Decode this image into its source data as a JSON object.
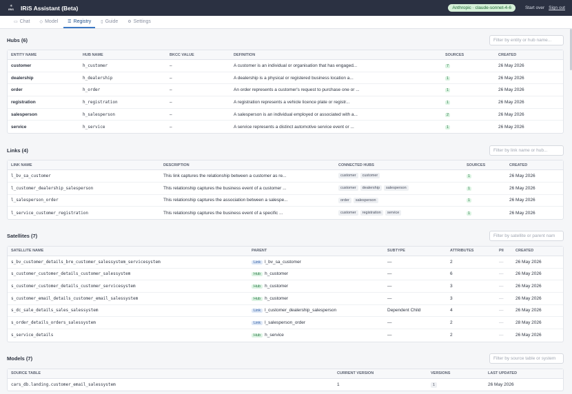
{
  "app": {
    "logo_text": "IRiS",
    "title": "IRiS Assistant (Beta)",
    "model": "Anthropic · claude-sonnet-4-6",
    "start_over": "Start over",
    "sign_out": "Sign out"
  },
  "tabs": [
    {
      "label": "Chat",
      "icon": "chat-icon"
    },
    {
      "label": "Model",
      "icon": "model-icon"
    },
    {
      "label": "Registry",
      "icon": "registry-icon"
    },
    {
      "label": "Guide",
      "icon": "guide-icon"
    },
    {
      "label": "Settings",
      "icon": "settings-icon"
    }
  ],
  "active_tab": "Registry",
  "hubs": {
    "title": "Hubs (6)",
    "filter_placeholder": "Filter by entity or hub name...",
    "columns": [
      "Entity Name",
      "Hub Name",
      "BKCC Value",
      "Definition",
      "Sources",
      "Created"
    ],
    "rows": [
      {
        "entity": "customer",
        "hub": "h_customer",
        "bkcc": "–",
        "definition": "A customer is an individual or organisation that has engaged...",
        "sources": "7",
        "created": "26 May 2026"
      },
      {
        "entity": "dealership",
        "hub": "h_dealership",
        "bkcc": "–",
        "definition": "A dealership is a physical or registered business location a...",
        "sources": "1",
        "created": "26 May 2026"
      },
      {
        "entity": "order",
        "hub": "h_order",
        "bkcc": "–",
        "definition": "An order represents a customer's request to purchase one or ...",
        "sources": "1",
        "created": "26 May 2026"
      },
      {
        "entity": "registration",
        "hub": "h_registration",
        "bkcc": "–",
        "definition": "A registration represents a vehicle licence plate or registr...",
        "sources": "1",
        "created": "26 May 2026"
      },
      {
        "entity": "salesperson",
        "hub": "h_salesperson",
        "bkcc": "–",
        "definition": "A salesperson is an individual employed or associated with a...",
        "sources": "2",
        "created": "26 May 2026"
      },
      {
        "entity": "service",
        "hub": "h_service",
        "bkcc": "–",
        "definition": "A service represents a distinct automotive service event or ...",
        "sources": "1",
        "created": "26 May 2026"
      }
    ]
  },
  "links": {
    "title": "Links (4)",
    "filter_placeholder": "Filter by link name or hub...",
    "columns": [
      "Link Name",
      "Description",
      "Connected Hubs",
      "Sources",
      "Created"
    ],
    "rows": [
      {
        "name": "l_bv_sa_customer",
        "description": "This link captures the relationship between a customer as re...",
        "hubs": [
          "customer",
          "customer"
        ],
        "sources": "1",
        "created": "26 May 2026"
      },
      {
        "name": "l_customer_dealership_salesperson",
        "description": "This relationship captures the business event of a customer ...",
        "hubs": [
          "customer",
          "dealership",
          "salesperson"
        ],
        "sources": "1",
        "created": "26 May 2026"
      },
      {
        "name": "l_salesperson_order",
        "description": "This relationship captures the association between a salespe...",
        "hubs": [
          "order",
          "salesperson"
        ],
        "sources": "1",
        "created": "26 May 2026"
      },
      {
        "name": "l_service_customer_registration",
        "description": "This relationship captures the business event of a specific ...",
        "hubs": [
          "customer",
          "registration",
          "service"
        ],
        "sources": "1",
        "created": "26 May 2026"
      }
    ]
  },
  "satellites": {
    "title": "Satellites (7)",
    "filter_placeholder": "Filter by satellite or parent nam",
    "columns": [
      "Satellite Name",
      "Parent",
      "Subtype",
      "Attributes",
      "PII",
      "Created"
    ],
    "rows": [
      {
        "name": "s_bv_customer_details_bre_customer_salessystem_servicesystem",
        "ptype": "Link",
        "parent": "l_bv_sa_customer",
        "subtype": "—",
        "attributes": "2",
        "pii": "—",
        "created": "26 May 2026"
      },
      {
        "name": "s_customer_customer_details_customer_salessystem",
        "ptype": "Hub",
        "parent": "h_customer",
        "subtype": "—",
        "attributes": "6",
        "pii": "—",
        "created": "26 May 2026"
      },
      {
        "name": "s_customer_customer_details_customer_servicesystem",
        "ptype": "Hub",
        "parent": "h_customer",
        "subtype": "—",
        "attributes": "3",
        "pii": "—",
        "created": "26 May 2026"
      },
      {
        "name": "s_customer_email_details_customer_email_salessystem",
        "ptype": "Hub",
        "parent": "h_customer",
        "subtype": "—",
        "attributes": "3",
        "pii": "—",
        "created": "26 May 2026"
      },
      {
        "name": "s_dc_sale_details_sales_salessystem",
        "ptype": "Link",
        "parent": "l_customer_dealership_salesperson",
        "subtype": "Dependent Child",
        "attributes": "4",
        "pii": "—",
        "created": "26 May 2026"
      },
      {
        "name": "s_order_details_orders_salessystem",
        "ptype": "Link",
        "parent": "l_salesperson_order",
        "subtype": "—",
        "attributes": "2",
        "pii": "—",
        "created": "28 May 2026"
      },
      {
        "name": "s_service_details",
        "ptype": "Hub",
        "parent": "h_service",
        "subtype": "—",
        "attributes": "2",
        "pii": "—",
        "created": "26 May 2026"
      }
    ]
  },
  "models": {
    "title": "Models (7)",
    "filter_placeholder": "Filter by source table or system",
    "columns": [
      "Source Table",
      "Current Version",
      "Versions",
      "Last Updated"
    ],
    "rows": [
      {
        "source": "cars_db.landing.customer_email_salessystem",
        "version": "1",
        "versions": "1",
        "updated": "26 May 2026"
      }
    ]
  }
}
